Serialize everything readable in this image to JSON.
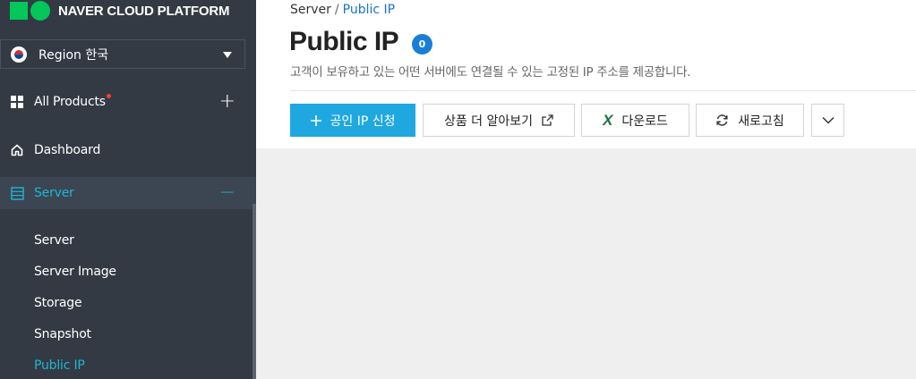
{
  "brand": {
    "name": "NAVER CLOUD PLATFORM"
  },
  "region": {
    "label": "Region 한국",
    "flag_icon": "korea-flag-icon"
  },
  "nav": {
    "all_products": {
      "label": "All Products",
      "action": "+"
    },
    "dashboard": {
      "label": "Dashboard"
    },
    "server": {
      "label": "Server",
      "action": "−"
    },
    "server_items": [
      {
        "label": "Server"
      },
      {
        "label": "Server Image"
      },
      {
        "label": "Storage"
      },
      {
        "label": "Snapshot"
      },
      {
        "label": "Public IP",
        "active": true
      }
    ]
  },
  "breadcrumb": {
    "parent": "Server",
    "separator": "/",
    "current": "Public IP"
  },
  "page": {
    "title": "Public IP",
    "count": "0",
    "description": "고객이 보유하고 있는 어떤 서버에도 연결될 수 있는 고정된 IP 주소를 제공합니다."
  },
  "toolbar": {
    "create_label": "공인 IP 신청",
    "learn_more_label": "상품 더 알아보기",
    "download_label": "다운로드",
    "refresh_label": "새로고침"
  },
  "colors": {
    "sidebar_bg": "#333a44",
    "accent": "#1fb6d3",
    "primary_button": "#1fa8e0",
    "badge": "#1a7ed6",
    "brand_green": "#03c75a"
  }
}
